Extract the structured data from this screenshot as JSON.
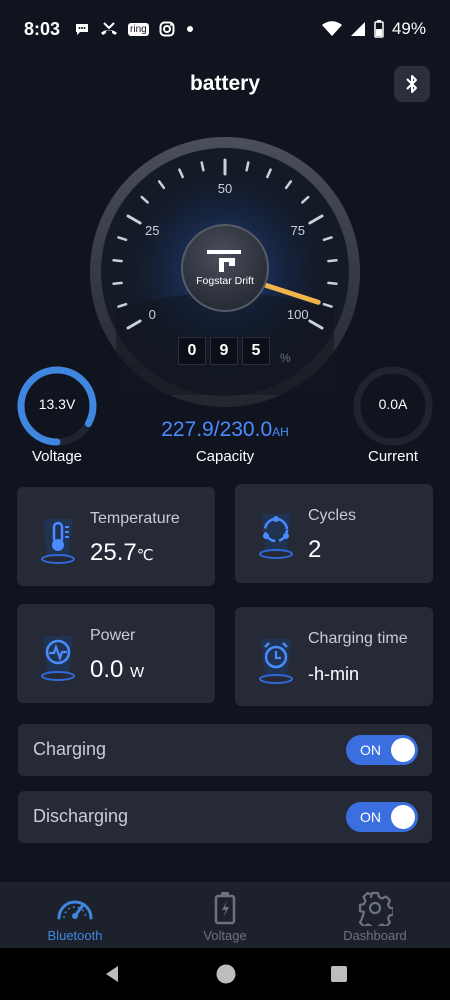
{
  "status_bar": {
    "time": "8:03",
    "ring_label": "ring",
    "battery_percent": "49%",
    "icons": [
      "message-icon",
      "missed-call-icon",
      "ring-icon",
      "instagram-icon",
      "dot-icon",
      "wifi-icon",
      "signal-icon",
      "battery-icon"
    ]
  },
  "header": {
    "title": "battery",
    "bluetooth_icon": "bluetooth-icon"
  },
  "gauge": {
    "scale_labels": [
      "0",
      "25",
      "50",
      "75",
      "100"
    ],
    "brand": "Fogstar Drift",
    "level_percent": 95,
    "digits": [
      "0",
      "9",
      "5"
    ],
    "percent_sign": "%"
  },
  "voltage": {
    "value": "13.3V",
    "label": "Voltage",
    "arc_fraction": 0.83,
    "color": "#3f86e0"
  },
  "current": {
    "value": "0.0A",
    "label": "Current",
    "arc_fraction": 0
  },
  "capacity": {
    "value": "227.9/230.0",
    "unit": "AH",
    "label": "Capacity",
    "color": "#4a8cff"
  },
  "cards": {
    "temperature": {
      "title": "Temperature",
      "value": "25.7",
      "unit": "℃",
      "icon": "thermometer-icon"
    },
    "cycles": {
      "title": "Cycles",
      "value": "2",
      "icon": "cycle-icon"
    },
    "power": {
      "title": "Power",
      "value": "0.0",
      "unit": "W",
      "icon": "power-icon"
    },
    "charging_time": {
      "title": "Charging time",
      "value": "-h-min",
      "icon": "alarm-clock-icon"
    }
  },
  "toggles": {
    "charging": {
      "label": "Charging",
      "state": "ON"
    },
    "discharging": {
      "label": "Discharging",
      "state": "ON"
    }
  },
  "bottom_nav": {
    "items": [
      {
        "label": "Bluetooth",
        "icon": "speedometer-icon",
        "active": true
      },
      {
        "label": "Voltage",
        "icon": "battery-charging-icon",
        "active": false
      },
      {
        "label": "Dashboard",
        "icon": "gear-icon",
        "active": false
      }
    ],
    "active_color": "#3f86e0",
    "inactive_color": "#6c7280"
  }
}
